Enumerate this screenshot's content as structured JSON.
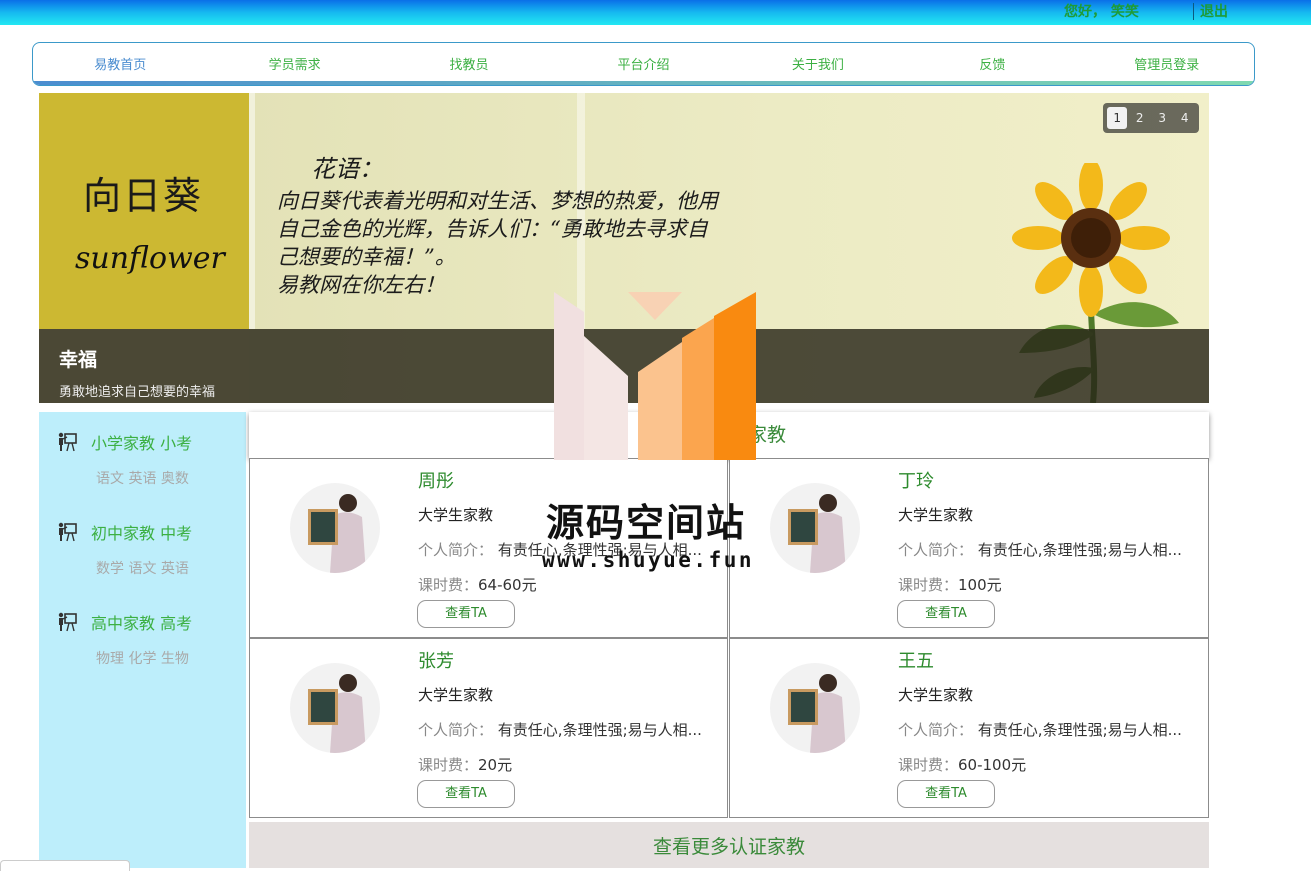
{
  "header": {
    "greeting": "您好， 笑笑",
    "logout": "退出"
  },
  "nav": {
    "items": [
      "易教首页",
      "学员需求",
      "找教员",
      "平台介绍",
      "关于我们",
      "反馈",
      "管理员登录"
    ],
    "active_index": 0
  },
  "banner": {
    "left_title": "向日葵",
    "left_subtitle": "sunflower",
    "verse_title": "花语：",
    "verse_lines": [
      "向日葵代表着光明和对生活、梦想的热爱，他用",
      "自己金色的光辉，告诉人们：“勇敢地去寻求自",
      "己想要的幸福！”。",
      "易教网在你左右！"
    ],
    "caption_title": "幸福",
    "caption_subtitle": "勇敢地追求自己想要的幸福",
    "pages": [
      "1",
      "2",
      "3",
      "4"
    ],
    "current_page": 1
  },
  "sidebar": {
    "groups": [
      {
        "title": "小学家教 小考",
        "subjects": "语文 英语 奥数"
      },
      {
        "title": "初中家教 中考",
        "subjects": "数学 语文 英语"
      },
      {
        "title": "高中家教 高考",
        "subjects": "物理 化学 生物"
      }
    ]
  },
  "section_title": "最新认证家教",
  "tutors": [
    {
      "name": "周彤",
      "type": "大学生家教",
      "intro_label": "个人简介：",
      "intro": "有责任心,条理性强;易与人相...",
      "fee_label": "课时费：",
      "fee": "64-60元",
      "button": "查看TA"
    },
    {
      "name": "丁玲",
      "type": "大学生家教",
      "intro_label": "个人简介：",
      "intro": "有责任心,条理性强;易与人相...",
      "fee_label": "课时费：",
      "fee": "100元",
      "button": "查看TA"
    },
    {
      "name": "张芳",
      "type": "大学生家教",
      "intro_label": "个人简介：",
      "intro": "有责任心,条理性强;易与人相...",
      "fee_label": "课时费：",
      "fee": "20元",
      "button": "查看TA"
    },
    {
      "name": "王五",
      "type": "大学生家教",
      "intro_label": "个人简介：",
      "intro": "有责任心,条理性强;易与人相...",
      "fee_label": "课时费：",
      "fee": "60-100元",
      "button": "查看TA"
    }
  ],
  "more_button": "查看更多认证家教",
  "watermark": {
    "title": "源码空间站",
    "url": "www.shuyue.fun"
  },
  "colors": {
    "accent_green": "#3cb043",
    "nav_active": "#4b8dd0",
    "sidebar_bg": "#bdeefb"
  }
}
